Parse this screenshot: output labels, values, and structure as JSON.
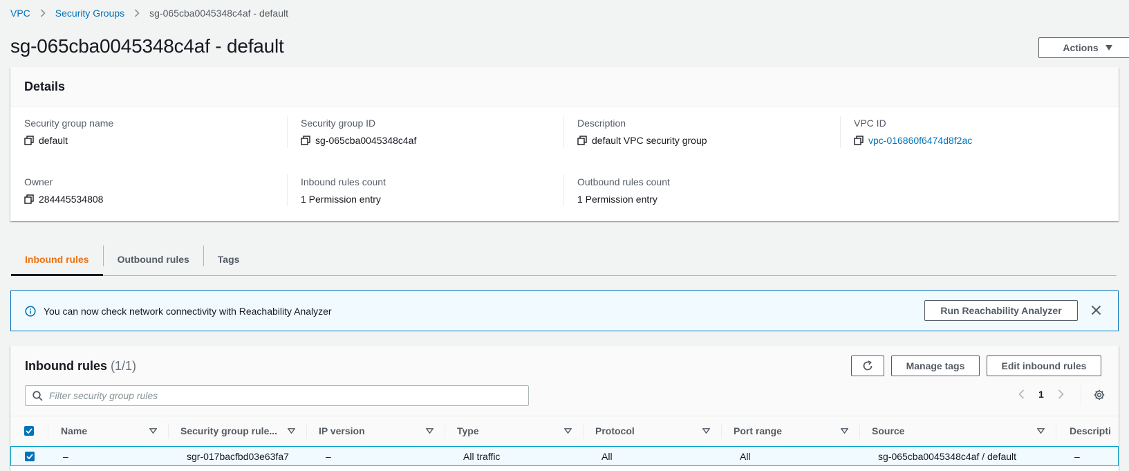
{
  "breadcrumb": {
    "items": [
      "VPC",
      "Security Groups"
    ],
    "current": "sg-065cba0045348c4af - default"
  },
  "page": {
    "title": "sg-065cba0045348c4af - default",
    "actions_label": "Actions"
  },
  "details": {
    "heading": "Details",
    "fields": {
      "sg_name": {
        "label": "Security group name",
        "value": "default"
      },
      "sg_id": {
        "label": "Security group ID",
        "value": "sg-065cba0045348c4af"
      },
      "description": {
        "label": "Description",
        "value": "default VPC security group"
      },
      "vpc_id": {
        "label": "VPC ID",
        "value": "vpc-016860f6474d8f2ac"
      },
      "owner": {
        "label": "Owner",
        "value": "284445534808"
      },
      "inbound_count": {
        "label": "Inbound rules count",
        "value": "1 Permission entry"
      },
      "outbound_count": {
        "label": "Outbound rules count",
        "value": "1 Permission entry"
      }
    }
  },
  "tabs": [
    {
      "label": "Inbound rules",
      "active": true
    },
    {
      "label": "Outbound rules",
      "active": false
    },
    {
      "label": "Tags",
      "active": false
    }
  ],
  "banner": {
    "text": "You can now check network connectivity with Reachability Analyzer",
    "button_label": "Run Reachability Analyzer"
  },
  "inbound": {
    "title": "Inbound rules",
    "count": "(1/1)",
    "manage_tags_label": "Manage tags",
    "edit_label": "Edit inbound rules",
    "filter_placeholder": "Filter security group rules",
    "page_number": "1",
    "columns": [
      "Name",
      "Security group rule...",
      "IP version",
      "Type",
      "Protocol",
      "Port range",
      "Source",
      "Descripti"
    ],
    "rows": [
      {
        "name": "–",
        "rule_id": "sgr-017bacfbd03e63fa7",
        "ip_version": "–",
        "type": "All traffic",
        "protocol": "All",
        "port_range": "All",
        "source": "sg-065cba0045348c4af / default",
        "description": "–"
      }
    ]
  },
  "colors": {
    "link": "#0073bb",
    "active_tab": "#ec7211",
    "banner_bg": "#f1faff",
    "selected_row_border": "#00a1c9"
  }
}
